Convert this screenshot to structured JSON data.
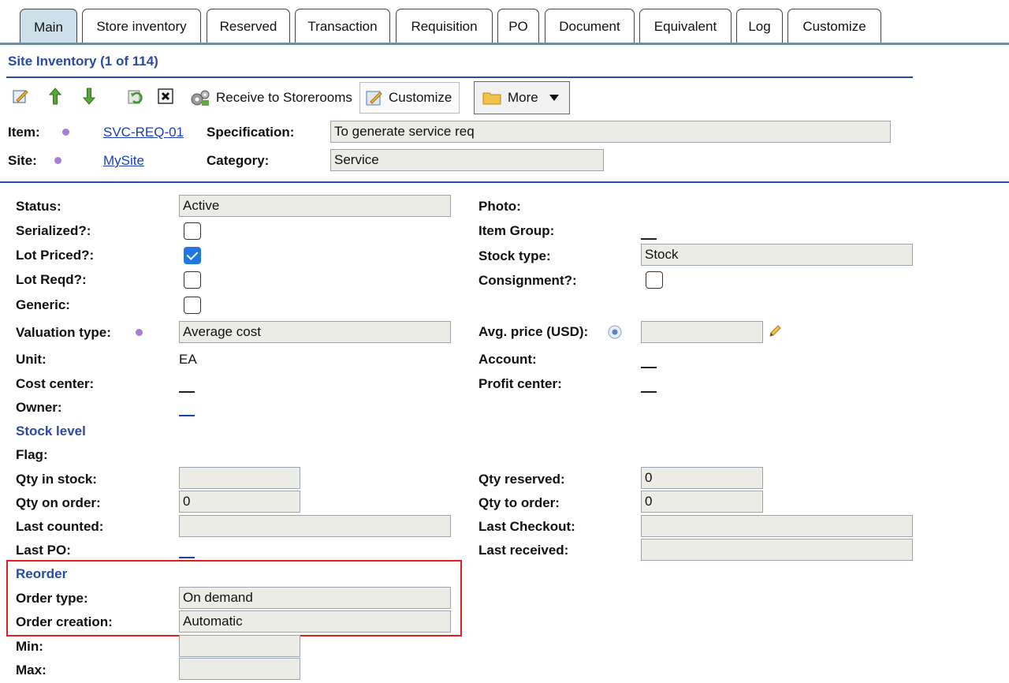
{
  "tabs": [
    "Main",
    "Store inventory",
    "Reserved",
    "Transaction",
    "Requisition",
    "PO",
    "Document",
    "Equivalent",
    "Log",
    "Customize"
  ],
  "header": {
    "title": "Site Inventory (1 of 114)"
  },
  "toolbar": {
    "receive_label": "Receive to Storerooms",
    "customize_label": "Customize",
    "more_label": "More"
  },
  "record": {
    "item_label": "Item:",
    "item_value": "SVC-REQ-01",
    "spec_label": "Specification:",
    "spec_value": "To generate service req",
    "site_label": "Site:",
    "site_value": "MySite",
    "category_label": "Category:",
    "category_value": "Service"
  },
  "left": {
    "status_label": "Status:",
    "status_value": "Active",
    "serialized_label": "Serialized?:",
    "serialized": false,
    "lot_priced_label": "Lot Priced?:",
    "lot_priced": true,
    "lot_reqd_label": "Lot Reqd?:",
    "lot_reqd": false,
    "generic_label": "Generic:",
    "generic": false,
    "valuation_label": "Valuation type:",
    "valuation_value": "Average cost",
    "unit_label": "Unit:",
    "unit_value": "EA",
    "cost_center_label": "Cost center:",
    "owner_label": "Owner:"
  },
  "right": {
    "photo_label": "Photo:",
    "item_group_label": "Item Group:",
    "stock_type_label": "Stock type:",
    "stock_type_value": "Stock",
    "consignment_label": "Consignment?:",
    "consignment": false,
    "avg_price_label": "Avg. price (USD):",
    "avg_price_value": "",
    "account_label": "Account:",
    "profit_center_label": "Profit center:"
  },
  "stock": {
    "section_label": "Stock level",
    "flag_label": "Flag:",
    "qty_in_stock_label": "Qty in stock:",
    "qty_in_stock_value": "",
    "qty_reserved_label": "Qty reserved:",
    "qty_reserved_value": "0",
    "qty_on_order_label": "Qty on order:",
    "qty_on_order_value": "0",
    "qty_to_order_label": "Qty to order:",
    "qty_to_order_value": "0",
    "last_counted_label": "Last counted:",
    "last_counted_value": "",
    "last_checkout_label": "Last Checkout:",
    "last_checkout_value": "",
    "last_po_label": "Last PO:",
    "last_received_label": "Last received:",
    "last_received_value": ""
  },
  "reorder": {
    "section_label": "Reorder",
    "order_type_label": "Order type:",
    "order_type_value": "On demand",
    "order_creation_label": "Order creation:",
    "order_creation_value": "Automatic",
    "min_label": "Min:",
    "min_value": "",
    "max_label": "Max:",
    "max_value": ""
  },
  "colors": {
    "accent": "#2b4aa7",
    "tab_active": "#cde0ea",
    "highlight": "#e0201c",
    "checkbox_on": "#1f78e0"
  }
}
